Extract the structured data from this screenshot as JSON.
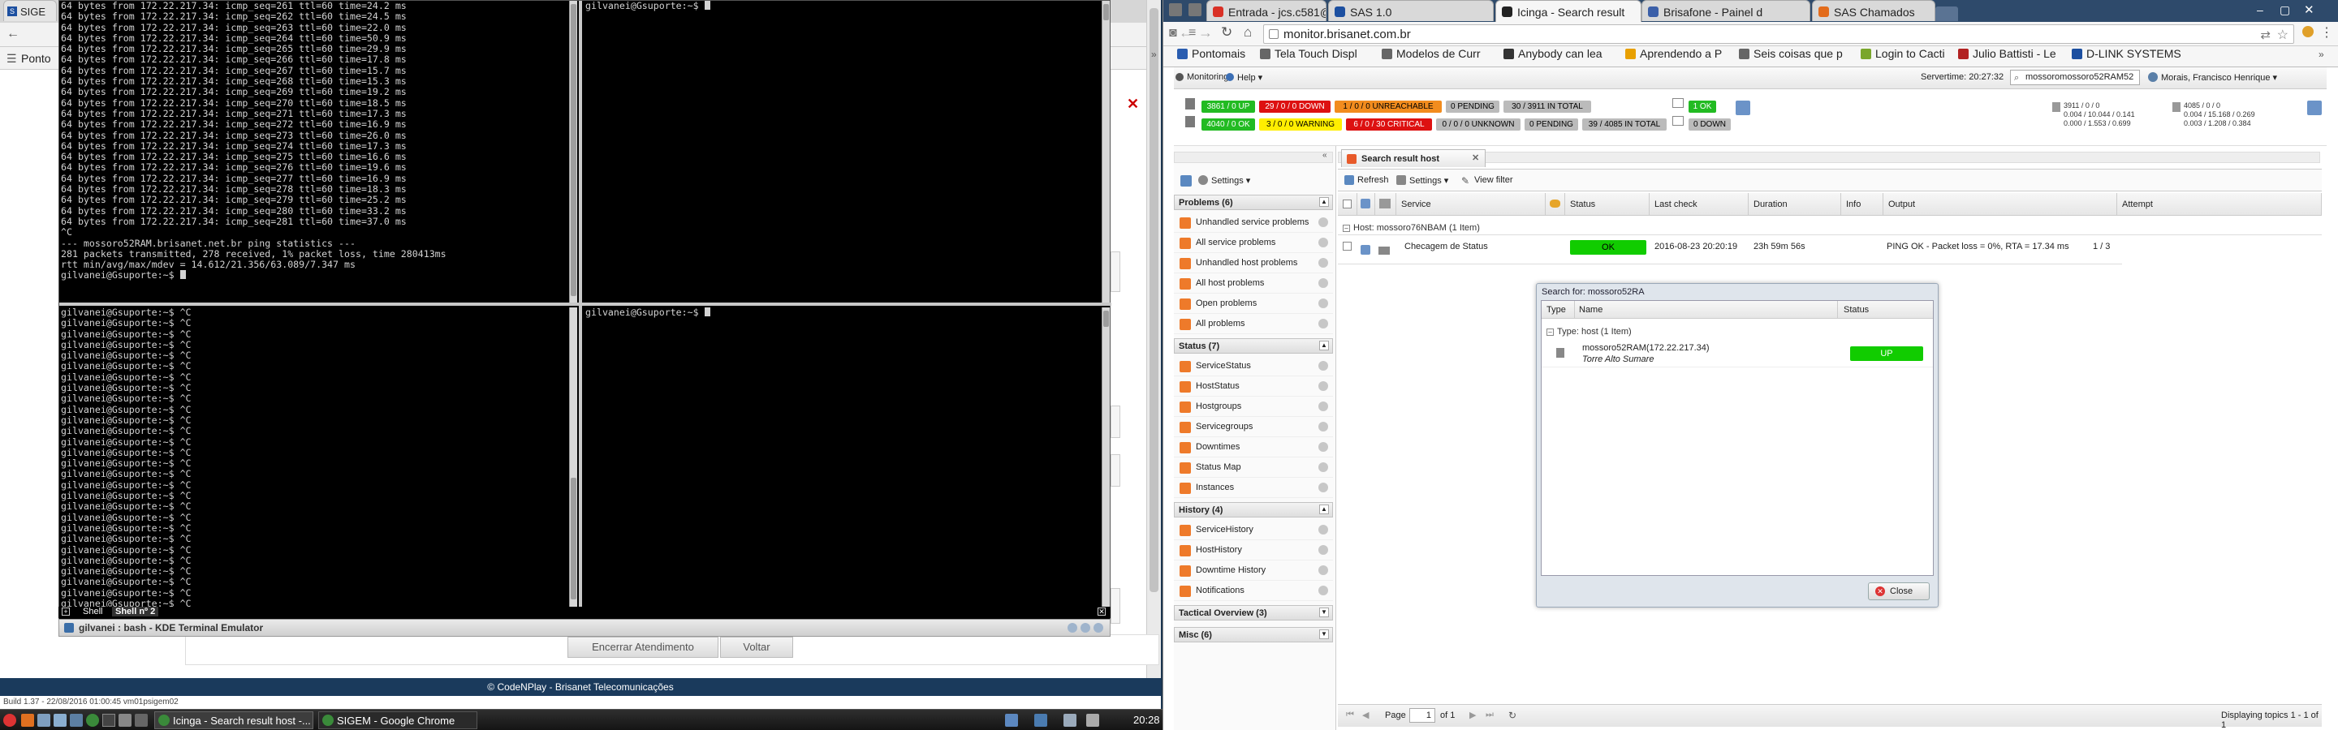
{
  "left_browser": {
    "tabs": [
      {
        "label": "SIGE"
      }
    ],
    "bookmarks": [
      {
        "label": "Ponto"
      }
    ],
    "page_buttons": {
      "end_service": "Encerrar Atendimento",
      "back": "Voltar"
    },
    "footer": "© CodeNPlay - Brisanet Telecomunicações",
    "build_info": "Build 1.37 - 22/08/2016 01:00:45 vm01psigem02"
  },
  "terminal": {
    "top_left_lines": [
      "64 bytes from 172.22.217.34: icmp_seq=261 ttl=60 time=24.2 ms",
      "64 bytes from 172.22.217.34: icmp_seq=262 ttl=60 time=24.5 ms",
      "64 bytes from 172.22.217.34: icmp_seq=263 ttl=60 time=22.0 ms",
      "64 bytes from 172.22.217.34: icmp_seq=264 ttl=60 time=50.9 ms",
      "64 bytes from 172.22.217.34: icmp_seq=265 ttl=60 time=29.9 ms",
      "64 bytes from 172.22.217.34: icmp_seq=266 ttl=60 time=17.8 ms",
      "64 bytes from 172.22.217.34: icmp_seq=267 ttl=60 time=15.7 ms",
      "64 bytes from 172.22.217.34: icmp_seq=268 ttl=60 time=15.3 ms",
      "64 bytes from 172.22.217.34: icmp_seq=269 ttl=60 time=19.2 ms",
      "64 bytes from 172.22.217.34: icmp_seq=270 ttl=60 time=18.5 ms",
      "64 bytes from 172.22.217.34: icmp_seq=271 ttl=60 time=17.3 ms",
      "64 bytes from 172.22.217.34: icmp_seq=272 ttl=60 time=16.9 ms",
      "64 bytes from 172.22.217.34: icmp_seq=273 ttl=60 time=26.0 ms",
      "64 bytes from 172.22.217.34: icmp_seq=274 ttl=60 time=17.3 ms",
      "64 bytes from 172.22.217.34: icmp_seq=275 ttl=60 time=16.6 ms",
      "64 bytes from 172.22.217.34: icmp_seq=276 ttl=60 time=19.6 ms",
      "64 bytes from 172.22.217.34: icmp_seq=277 ttl=60 time=16.9 ms",
      "64 bytes from 172.22.217.34: icmp_seq=278 ttl=60 time=18.3 ms",
      "64 bytes from 172.22.217.34: icmp_seq=279 ttl=60 time=25.2 ms",
      "64 bytes from 172.22.217.34: icmp_seq=280 ttl=60 time=33.2 ms",
      "64 bytes from 172.22.217.34: icmp_seq=281 ttl=60 time=37.0 ms",
      "^C",
      "--- mossoro52RAM.brisanet.net.br ping statistics ---",
      "281 packets transmitted, 278 received, 1% packet loss, time 280413ms",
      "rtt min/avg/max/mdev = 14.612/21.356/63.089/7.347 ms",
      "gilvanei@Gsuporte:~$ "
    ],
    "top_right_lines": [
      "gilvanei@Gsuporte:~$ "
    ],
    "bottom_left_lines": [
      "gilvanei@Gsuporte:~$ ^C",
      "gilvanei@Gsuporte:~$ ^C",
      "gilvanei@Gsuporte:~$ ^C",
      "gilvanei@Gsuporte:~$ ^C",
      "gilvanei@Gsuporte:~$ ^C",
      "gilvanei@Gsuporte:~$ ^C",
      "gilvanei@Gsuporte:~$ ^C",
      "gilvanei@Gsuporte:~$ ^C",
      "gilvanei@Gsuporte:~$ ^C",
      "gilvanei@Gsuporte:~$ ^C",
      "gilvanei@Gsuporte:~$ ^C",
      "gilvanei@Gsuporte:~$ ^C",
      "gilvanei@Gsuporte:~$ ^C",
      "gilvanei@Gsuporte:~$ ^C",
      "gilvanei@Gsuporte:~$ ^C",
      "gilvanei@Gsuporte:~$ ^C",
      "gilvanei@Gsuporte:~$ ^C",
      "gilvanei@Gsuporte:~$ ^C",
      "gilvanei@Gsuporte:~$ ^C",
      "gilvanei@Gsuporte:~$ ^C",
      "gilvanei@Gsuporte:~$ ^C",
      "gilvanei@Gsuporte:~$ ^C",
      "gilvanei@Gsuporte:~$ ^C",
      "gilvanei@Gsuporte:~$ ^C",
      "gilvanei@Gsuporte:~$ ^C",
      "gilvanei@Gsuporte:~$ ^C",
      "gilvanei@Gsuporte:~$ ^C",
      "gilvanei@Gsuporte:~$ ^C",
      "gilvanei@Gsuporte:~$ "
    ],
    "bottom_right_lines": [
      "gilvanei@Gsuporte:~$ "
    ],
    "tabs": [
      "Shell",
      "Shell nº 2"
    ],
    "window_title": "gilvanei : bash - KDE Terminal Emulator"
  },
  "taskbar": {
    "items": [
      "Icinga - Search result host -...",
      "SIGEM - Google Chrome"
    ],
    "clock": "20:28"
  },
  "right_browser": {
    "tabs": [
      {
        "label": "Entrada - jcs.c581@",
        "color": "#d93025"
      },
      {
        "label": "SAS 1.0",
        "color": "#1c4fa0"
      },
      {
        "label": "Icinga - Search result",
        "color": "#222222"
      },
      {
        "label": "Brisafone - Painel d",
        "color": "#3b5fa8"
      },
      {
        "label": "SAS Chamados",
        "color": "#e36c1c"
      }
    ],
    "url": "monitor.brisanet.com.br",
    "bookmarks": [
      {
        "label": "Pontomais",
        "color": "#2a5db0"
      },
      {
        "label": "Tela Touch Displ",
        "color": "#666666"
      },
      {
        "label": "Modelos de Curr",
        "color": "#666666"
      },
      {
        "label": "Anybody can lea",
        "color": "#333333"
      },
      {
        "label": "Aprendendo a P",
        "color": "#e8a000"
      },
      {
        "label": "Seis coisas que p",
        "color": "#666666"
      },
      {
        "label": "Login to Cacti",
        "color": "#7aa62c"
      },
      {
        "label": "Julio Battisti - Le",
        "color": "#b22222"
      },
      {
        "label": "D-LINK SYSTEMS",
        "color": "#1c4fa0"
      }
    ]
  },
  "icinga": {
    "menu": {
      "monitoring": "Monitoring",
      "help": "Help"
    },
    "servertime": "Servertime: 20:27:32",
    "search_value": "mossoromossoro52RAM52",
    "user": "Morais, Francisco Henrique",
    "host_status": [
      {
        "label": "3861 / 0 UP",
        "color": "#22bb22",
        "text_color": "#ffffff"
      },
      {
        "label": "29 / 0 / 0 DOWN",
        "color": "#dd1111",
        "text_color": "#ffffff"
      },
      {
        "label": "1 / 0 / 0 UNREACHABLE",
        "color": "#f28c1e",
        "text_color": "#000000"
      },
      {
        "label": "0 PENDING",
        "color": "#bbbbbb",
        "text_color": "#000000"
      },
      {
        "label": "30 / 3911 IN TOTAL",
        "color": "#bbbbbb",
        "text_color": "#000000"
      }
    ],
    "service_status": [
      {
        "label": "4040 / 0 OK",
        "color": "#22bb22",
        "text_color": "#ffffff"
      },
      {
        "label": "3 / 0 / 0 WARNING",
        "color": "#ffee00",
        "text_color": "#000000"
      },
      {
        "label": "6 / 0 / 30 CRITICAL",
        "color": "#dd1111",
        "text_color": "#ffffff"
      },
      {
        "label": "0 / 0 / 0 UNKNOWN",
        "color": "#bbbbbb",
        "text_color": "#000000"
      },
      {
        "label": "0 PENDING",
        "color": "#bbbbbb",
        "text_color": "#000000"
      },
      {
        "label": "39 / 4085 IN TOTAL",
        "color": "#bbbbbb",
        "text_color": "#000000"
      }
    ],
    "mini_ok": "1 OK",
    "mini_down": "0 DOWN",
    "stats": {
      "col1": [
        "3911 / 0 / 0",
        "0.004 / 10.044 / 0.141",
        "0.000 / 1.553 / 0.699"
      ],
      "col2": [
        "4085 / 0 / 0",
        "0.004 / 15.168 / 0.269",
        "0.003 / 1.208 / 0.384"
      ]
    },
    "nav": {
      "settings": "Settings",
      "sections": [
        {
          "title": "Problems (6)",
          "items": [
            "Unhandled service problems",
            "All service problems",
            "Unhandled host problems",
            "All host problems",
            "Open problems",
            "All problems"
          ]
        },
        {
          "title": "Status (7)",
          "items": [
            "ServiceStatus",
            "HostStatus",
            "Hostgroups",
            "Servicegroups",
            "Downtimes",
            "Status Map",
            "Instances"
          ]
        },
        {
          "title": "History (4)",
          "items": [
            "ServiceHistory",
            "HostHistory",
            "Downtime History",
            "Notifications"
          ]
        },
        {
          "title": "Tactical Overview (3)",
          "items": []
        },
        {
          "title": "Misc (6)",
          "items": []
        }
      ]
    },
    "main": {
      "tab_title": "Search result host",
      "toolbar": {
        "refresh": "Refresh",
        "settings": "Settings",
        "view_filter": "View filter"
      },
      "columns": [
        "Service",
        "Status",
        "Last check",
        "Duration",
        "Info",
        "Output",
        "Attempt"
      ],
      "group_header": "Host: mossoro76NBAM (1 Item)",
      "row": {
        "service": "Checagem de Status",
        "status": "OK",
        "last_check": "2016-08-23 20:20:19",
        "duration": "23h 59m 56s",
        "output": "PING OK - Packet loss = 0%, RTA = 17.34 ms",
        "attempt": "1 / 3"
      },
      "pager": {
        "page_label": "Page",
        "page_value": "1",
        "of_label": "of 1",
        "displaying": "Displaying topics 1 - 1 of 1"
      }
    },
    "search_dialog": {
      "title": "Search for: mossoro52RA",
      "columns": [
        "Type",
        "Name",
        "Status"
      ],
      "group": "Type: host (1 Item)",
      "host_name": "mossoro52RAM(172.22.217.34)",
      "host_alias": "Torre Alto Sumare",
      "status": "UP",
      "close": "Close"
    }
  }
}
